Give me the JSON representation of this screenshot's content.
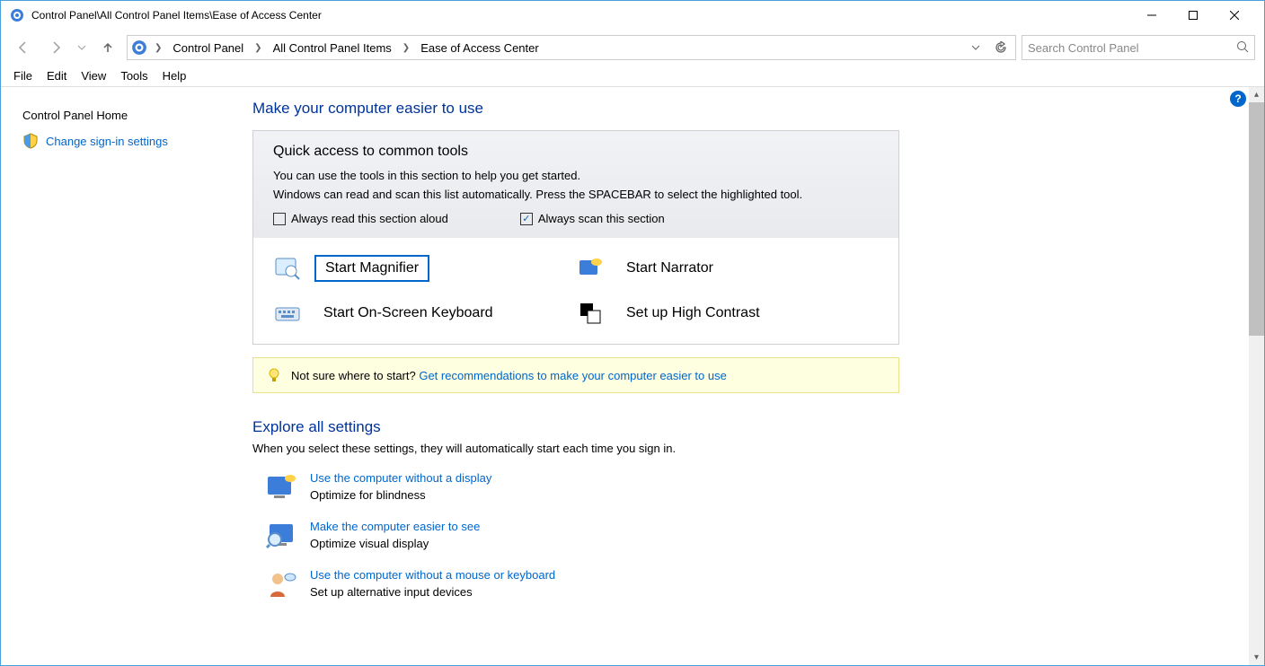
{
  "window": {
    "title": "Control Panel\\All Control Panel Items\\Ease of Access Center"
  },
  "breadcrumb": {
    "parts": [
      "Control Panel",
      "All Control Panel Items",
      "Ease of Access Center"
    ]
  },
  "search": {
    "placeholder": "Search Control Panel"
  },
  "menubar": {
    "items": [
      "File",
      "Edit",
      "View",
      "Tools",
      "Help"
    ]
  },
  "sidebar": {
    "home": "Control Panel Home",
    "change_signin": "Change sign-in settings"
  },
  "main": {
    "heading": "Make your computer easier to use",
    "quick": {
      "title": "Quick access to common tools",
      "desc1": "You can use the tools in this section to help you get started.",
      "desc2": "Windows can read and scan this list automatically.  Press the SPACEBAR to select the highlighted tool.",
      "check_read": {
        "label": "Always read this section aloud",
        "checked": false
      },
      "check_scan": {
        "label": "Always scan this section",
        "checked": true
      },
      "tools": {
        "magnifier": "Start Magnifier",
        "narrator": "Start Narrator",
        "osk": "Start On-Screen Keyboard",
        "contrast": "Set up High Contrast"
      }
    },
    "tip": {
      "prefix": "Not sure where to start? ",
      "link": "Get recommendations to make your computer easier to use"
    },
    "explore": {
      "heading": "Explore all settings",
      "desc": "When you select these settings, they will automatically start each time you sign in.",
      "items": [
        {
          "link": "Use the computer without a display",
          "sub": "Optimize for blindness"
        },
        {
          "link": "Make the computer easier to see",
          "sub": "Optimize visual display"
        },
        {
          "link": "Use the computer without a mouse or keyboard",
          "sub": "Set up alternative input devices"
        }
      ]
    }
  }
}
